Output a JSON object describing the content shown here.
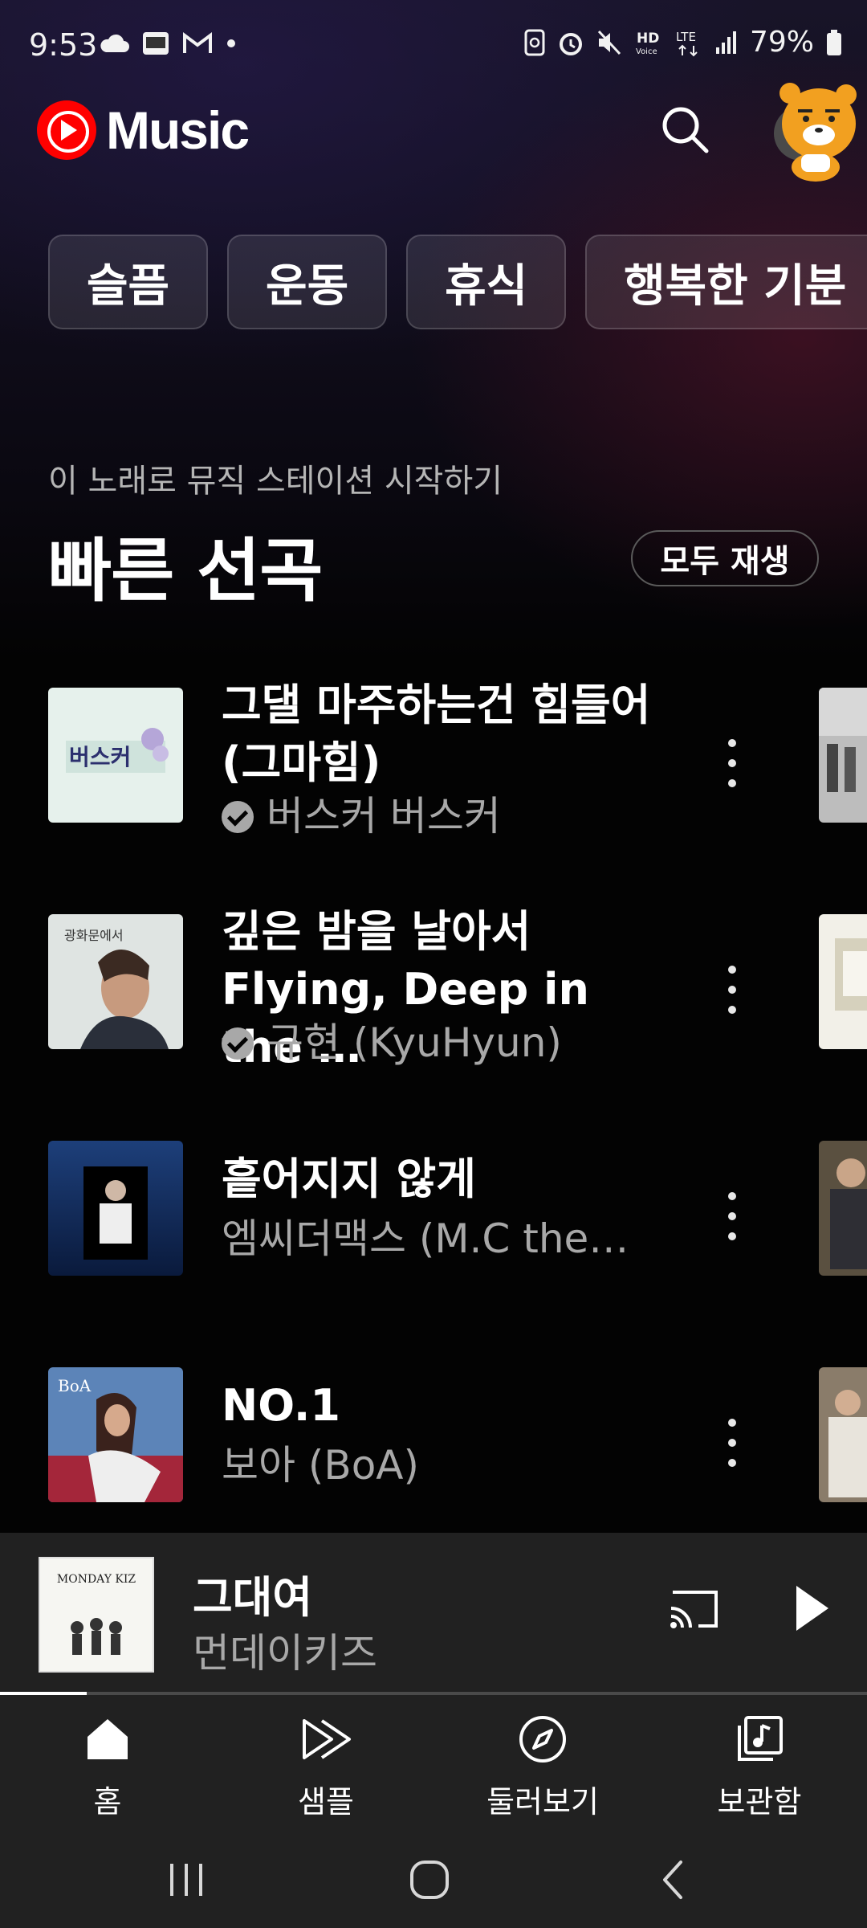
{
  "status_bar": {
    "time": "9:53",
    "left_icons": [
      "cloud-icon",
      "webtoon-icon",
      "gmail-icon",
      "dot-icon"
    ],
    "right_icons": [
      "nfc-icon",
      "alarm-icon",
      "mute-icon",
      "hd-voice-icon",
      "lte-icon",
      "signal-icon"
    ],
    "battery_text": "79%"
  },
  "header": {
    "app_name": "Music",
    "search_icon": "search-icon",
    "avatar_icon": "avatar-icon"
  },
  "chips": [
    {
      "label": "슬픔"
    },
    {
      "label": "운동"
    },
    {
      "label": "휴식"
    },
    {
      "label": "행복한 기분"
    }
  ],
  "section": {
    "subtitle": "이 노래로 뮤직 스테이션 시작하기",
    "title": "빠른 선곡",
    "play_all_label": "모두 재생"
  },
  "songs": [
    {
      "title": "그댈 마주하는건 힘들어 (그마힘)",
      "artist": "버스커 버스커",
      "verified": true
    },
    {
      "title": "깊은 밤을 날아서 Flying, Deep in the …",
      "artist": "규현 (KyuHyun)",
      "verified": true
    },
    {
      "title": "흩어지지 않게",
      "artist": "엠씨더맥스 (M.C the…",
      "verified": false
    },
    {
      "title": "NO.1",
      "artist": "보아 (BoA)",
      "verified": false
    }
  ],
  "mini_player": {
    "title": "그대여",
    "artist": "먼데이키즈",
    "progress": 0.1,
    "album_text": "MONDAY KIZ"
  },
  "bottom_nav": [
    {
      "label": "홈",
      "icon": "home-icon",
      "active": true
    },
    {
      "label": "샘플",
      "icon": "samples-icon",
      "active": false
    },
    {
      "label": "둘러보기",
      "icon": "explore-icon",
      "active": false
    },
    {
      "label": "보관함",
      "icon": "library-icon",
      "active": false
    }
  ],
  "system_nav": [
    "recents-icon",
    "home-circle-icon",
    "back-icon"
  ],
  "colors": {
    "accent": "#ff0000",
    "background": "#030303",
    "player_bg": "#212121",
    "secondary_text": "#a8a8a8"
  }
}
